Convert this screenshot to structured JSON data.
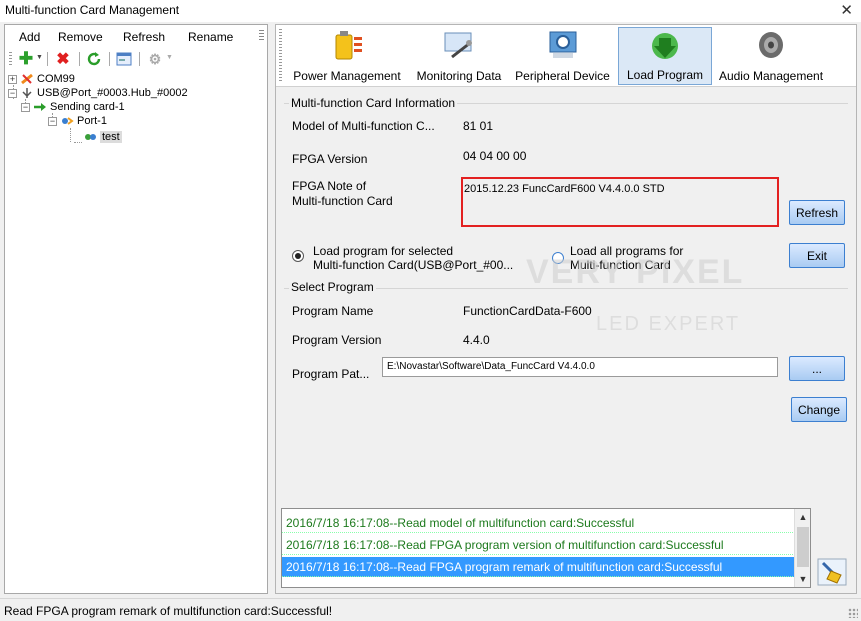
{
  "window": {
    "title": "Multi-function Card Management",
    "close_glyph": "✕"
  },
  "menu": {
    "items": [
      {
        "label": "Add"
      },
      {
        "label": "Remove"
      },
      {
        "label": "Refresh"
      },
      {
        "label": "Rename"
      }
    ]
  },
  "toolbar": {
    "icons": [
      "add-icon",
      "delete-icon",
      "refresh-icon",
      "card-icon",
      "settings-icon"
    ]
  },
  "tree": {
    "nodes": [
      {
        "label": "COM99",
        "expander": "+"
      },
      {
        "label": "USB@Port_#0003.Hub_#0002",
        "expander": "−"
      },
      {
        "label": "Sending card-1",
        "expander": "−"
      },
      {
        "label": "Port-1",
        "expander": "−"
      },
      {
        "label": "test"
      }
    ]
  },
  "tabs": [
    {
      "label": "Power Management",
      "icon": "battery-icon"
    },
    {
      "label": "Monitoring Data",
      "icon": "monitor-icon"
    },
    {
      "label": "Peripheral Device",
      "icon": "device-icon"
    },
    {
      "label": "Load Program",
      "icon": "download-arrow-icon",
      "active": true
    },
    {
      "label": "Audio Management",
      "icon": "speaker-icon"
    }
  ],
  "info": {
    "group_title": "Multi-function Card Information",
    "model_label": "Model of Multi-function C...",
    "model_value": "81 01",
    "fpga_version_label": "FPGA Version",
    "fpga_version_value": "04 04 00 00",
    "fpga_note_label_1": "FPGA Note of",
    "fpga_note_label_2": "Multi-function Card",
    "fpga_note_value": "2015.12.23 FuncCardF600 V4.4.0.0 STD",
    "refresh_button": "Refresh"
  },
  "load": {
    "radio_selected_line1": "Load program for selected",
    "radio_selected_line2": "Multi-function Card(USB@Port_#00...",
    "radio_all_line1": "Load all programs for",
    "radio_all_line2": "Multi-function Card",
    "selected_option": "selected",
    "exit_button": "Exit"
  },
  "program": {
    "group_title": "Select Program",
    "name_label": "Program Name",
    "name_value": "FunctionCardData-F600",
    "version_label": "Program Version",
    "version_value": "4.4.0",
    "path_label": "Program Pat...",
    "path_value": "E:\\Novastar\\Software\\Data_FuncCard  V4.4.0.0",
    "browse_button": "...",
    "change_button": "Change"
  },
  "watermark": {
    "line1": "VERY PIXEL",
    "line2": "LED EXPERT"
  },
  "log": {
    "entries": [
      {
        "text": "2016/7/18 16:17:08--Read model of multifunction card:Successful"
      },
      {
        "text": "2016/7/18 16:17:08--Read FPGA program version of multifunction card:Successful"
      },
      {
        "text": "2016/7/18 16:17:08--Read FPGA program remark of multifunction card:Successful",
        "selected": true
      }
    ],
    "clear_icon": "broom-icon"
  },
  "status": {
    "text": "Read FPGA program remark of multifunction card:Successful!"
  },
  "colors": {
    "accent": "#3399ff",
    "highlight_border": "#e32020",
    "log_text": "#1d7a1d"
  }
}
